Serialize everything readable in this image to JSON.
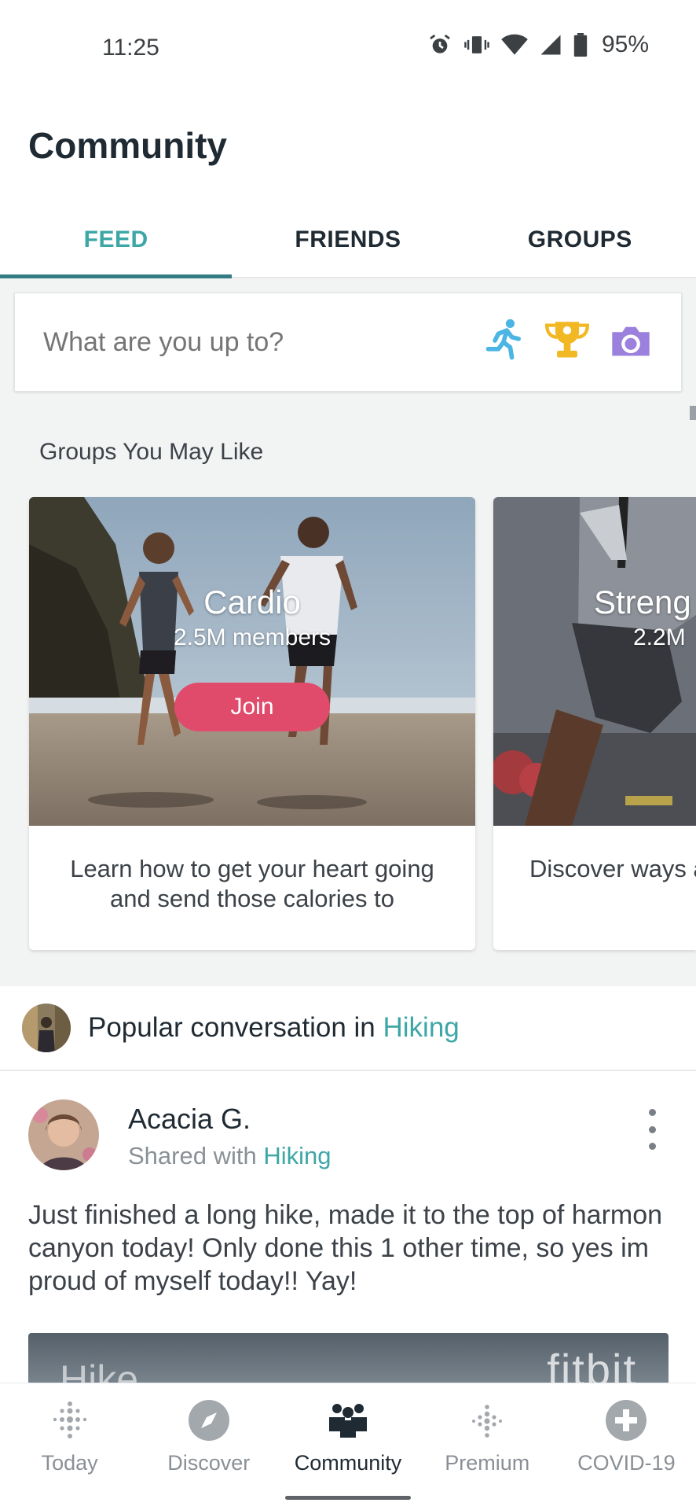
{
  "status_bar": {
    "time": "11:25",
    "battery": "95%"
  },
  "header": {
    "title": "Community"
  },
  "tabs": [
    {
      "label": "FEED",
      "active": true
    },
    {
      "label": "FRIENDS",
      "active": false
    },
    {
      "label": "GROUPS",
      "active": false
    }
  ],
  "compose": {
    "placeholder": "What are you up to?",
    "icons": [
      "running-person-icon",
      "trophy-icon",
      "camera-icon"
    ]
  },
  "groups_section": {
    "title": "Groups You May Like",
    "groups": [
      {
        "name": "Cardio",
        "members": "2.5M members",
        "join_label": "Join",
        "description": "Learn how to get your heart going and send those calories to"
      },
      {
        "name": "Streng",
        "members": "2.2M",
        "join_label": "",
        "description": "Discover ways and take your"
      }
    ]
  },
  "popular": {
    "prefix": "Popular conversation in ",
    "group": "Hiking"
  },
  "post": {
    "author": "Acacia G.",
    "shared_prefix": "Shared with ",
    "shared_group": "Hiking",
    "body": "Just finished a long hike, made it to the top of harmon canyon today! Only done this 1 other time, so yes im proud of myself today!! Yay!",
    "image_text_left": "Hike",
    "image_text_right": "fitbit"
  },
  "bottom_nav": [
    {
      "label": "Today",
      "icon": "fitbit-dots-icon",
      "active": false
    },
    {
      "label": "Discover",
      "icon": "compass-icon",
      "active": false
    },
    {
      "label": "Community",
      "icon": "people-icon",
      "active": true
    },
    {
      "label": "Premium",
      "icon": "premium-dots-icon",
      "active": false
    },
    {
      "label": "COVID-19",
      "icon": "plus-circle-icon",
      "active": false
    }
  ],
  "colors": {
    "accent": "#3da6a6",
    "tab_indicator": "#347c83",
    "join_button": "#e04b6c",
    "runner": "#4bb5e3",
    "trophy": "#f2b824",
    "camera": "#9b80dd"
  }
}
